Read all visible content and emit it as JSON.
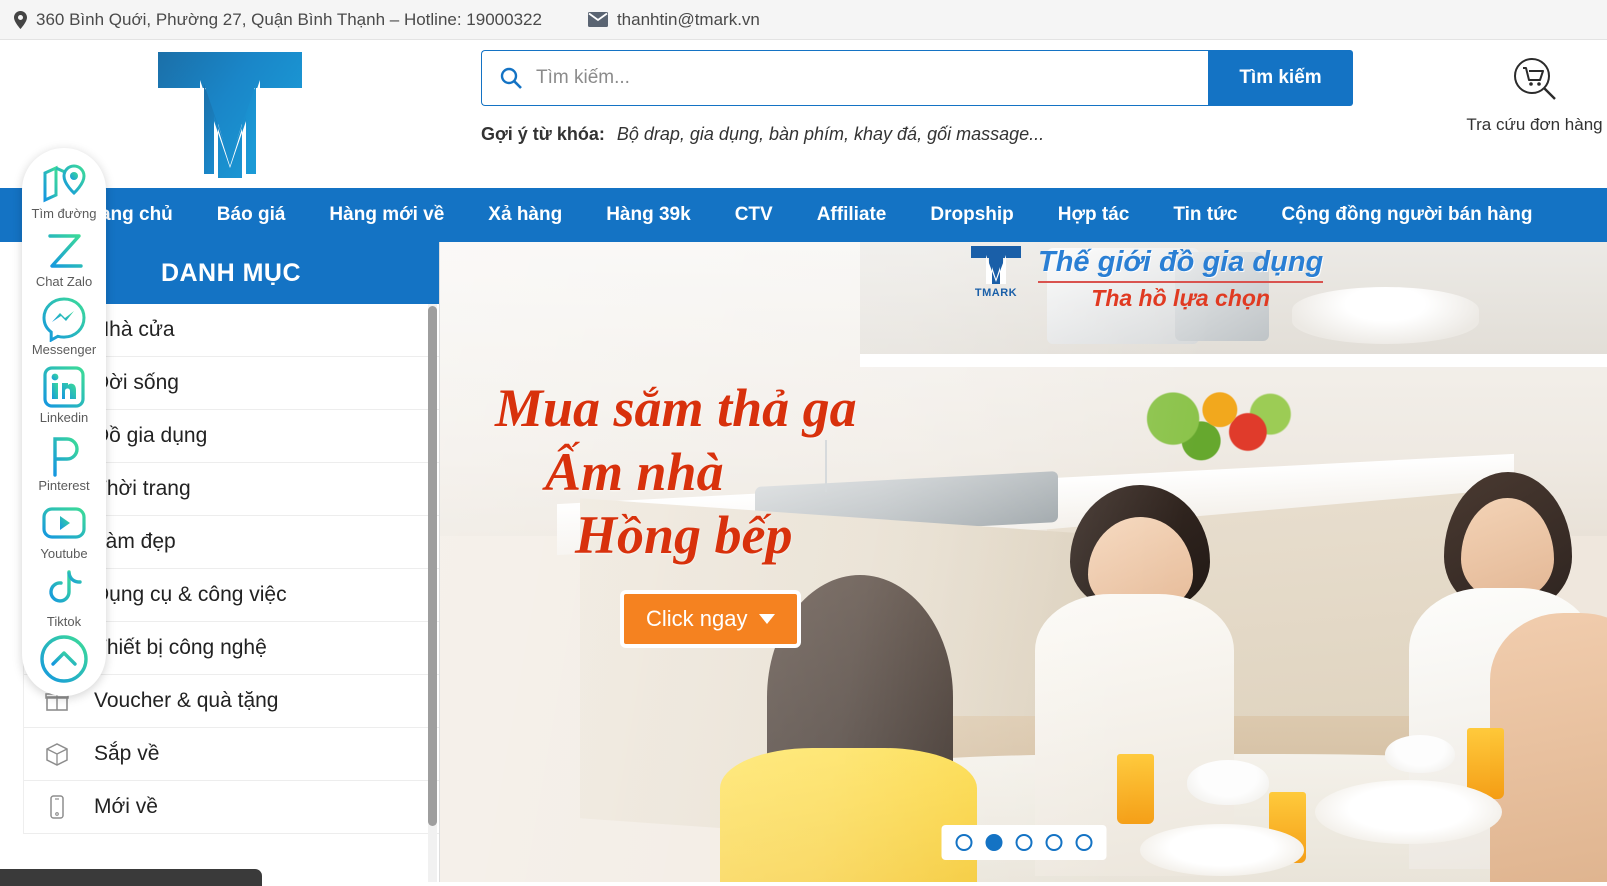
{
  "topbar": {
    "address_text": "360 Bình Quới, Phường 27, Quận Bình Thạnh – Hotline: 19000322",
    "email_text": "thanhtin@tmark.vn",
    "location_icon": "location-pin-icon",
    "email_icon": "envelope-icon"
  },
  "header": {
    "logo_alt": "TMARK",
    "search": {
      "placeholder": "Tìm kiếm...",
      "value": "",
      "button_label": "Tìm kiếm",
      "icon": "search-icon"
    },
    "keywords": {
      "label": "Gợi ý từ khóa:",
      "text": "Bộ drap, gia dụng, bàn phím, khay đá, gối massage..."
    },
    "order_lookup": {
      "label": "Tra cứu đơn hàng",
      "icon": "cart-search-icon"
    }
  },
  "nav": {
    "items": [
      {
        "label": "Trang chủ"
      },
      {
        "label": "Báo giá"
      },
      {
        "label": "Hàng mới về"
      },
      {
        "label": "Xả hàng"
      },
      {
        "label": "Hàng 39k"
      },
      {
        "label": "CTV"
      },
      {
        "label": "Affiliate"
      },
      {
        "label": "Dropship"
      },
      {
        "label": "Hợp tác"
      },
      {
        "label": "Tin tức"
      },
      {
        "label": "Cộng đồng người bán hàng"
      }
    ]
  },
  "sidebar": {
    "title": "DANH MỤC",
    "items": [
      {
        "label": "Nhà cửa",
        "icon": "house-icon"
      },
      {
        "label": "Đời sống",
        "icon": "lifestyle-icon"
      },
      {
        "label": "Đồ gia dụng",
        "icon": "appliance-icon"
      },
      {
        "label": "Thời trang",
        "icon": "fashion-icon"
      },
      {
        "label": "Làm đẹp",
        "icon": "beauty-icon"
      },
      {
        "label": "Dụng cụ & công việc",
        "icon": "tools-icon"
      },
      {
        "label": "Thiết bị công nghệ",
        "icon": "tech-icon"
      },
      {
        "label": "Voucher & quà tặng",
        "icon": "gift-icon"
      },
      {
        "label": "Sắp về",
        "icon": "box-icon"
      },
      {
        "label": "Mới về",
        "icon": "phone-icon"
      }
    ]
  },
  "banner": {
    "brand_mark": "TMARK",
    "brand_line1": "Thế giới đồ gia dụng",
    "brand_line2": "Tha hồ lựa chọn",
    "headline_line1": "Mua sắm thả ga",
    "headline_line2": "Ấm nhà",
    "headline_line3": "Hồng bếp",
    "cta_label": "Click ngay",
    "dots_total": 5,
    "dots_active_index": 1
  },
  "float_social": {
    "items": [
      {
        "label": "Tìm đường",
        "icon": "map-pin-icon"
      },
      {
        "label": "Chat Zalo",
        "icon": "zalo-icon"
      },
      {
        "label": "Messenger",
        "icon": "messenger-icon"
      },
      {
        "label": "Linkedin",
        "icon": "linkedin-icon"
      },
      {
        "label": "Pinterest",
        "icon": "pinterest-icon"
      },
      {
        "label": "Youtube",
        "icon": "youtube-icon"
      },
      {
        "label": "Tiktok",
        "icon": "tiktok-icon"
      }
    ],
    "scroll_top_icon": "chevron-up-circle-icon"
  },
  "statusbar": {
    "text": ""
  },
  "colors": {
    "brand_blue": "#1473c4",
    "accent_orange": "#f58220",
    "headline_red": "#d8310c",
    "topbar_bg": "#f5f5f5"
  }
}
